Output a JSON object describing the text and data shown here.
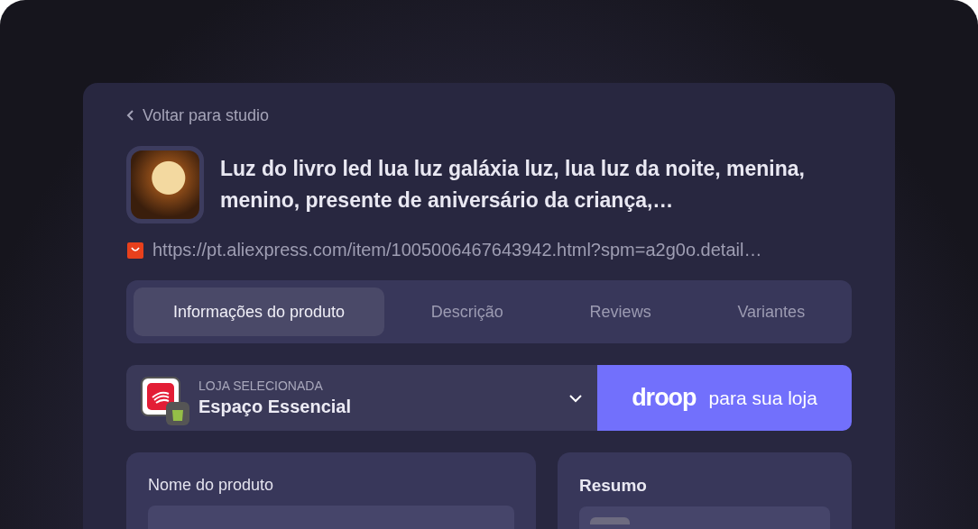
{
  "back_link": {
    "label": "Voltar para studio"
  },
  "product": {
    "title": "Luz do livro led lua luz galáxia luz, lua luz da noite, menina, menino, presente de aniversário da criança,…",
    "url": "https://pt.aliexpress.com/item/1005006467643942.html?spm=a2g0o.detail…"
  },
  "tabs": [
    {
      "label": "Informações do produto",
      "selected": true
    },
    {
      "label": "Descrição",
      "selected": false
    },
    {
      "label": "Reviews",
      "selected": false
    },
    {
      "label": "Variantes",
      "selected": false
    }
  ],
  "store": {
    "caption": "LOJA SELECIONADA",
    "name": "Espaço Essencial"
  },
  "droop_button": {
    "logo": "droop",
    "label": "para sua loja"
  },
  "form": {
    "field_label": "Nome do produto"
  },
  "summary": {
    "title": "Resumo"
  }
}
